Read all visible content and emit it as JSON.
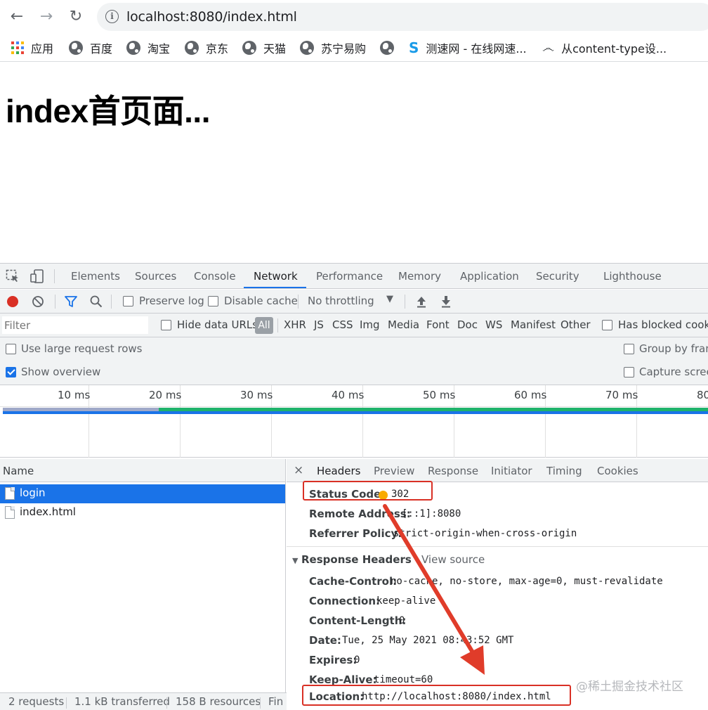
{
  "browser": {
    "url": "localhost:8080/index.html",
    "bookmarks": [
      "应用",
      "百度",
      "淘宝",
      "京东",
      "天猫",
      "苏宁易购",
      "",
      "测速网 - 在线网速...",
      "从content-type设..."
    ]
  },
  "page": {
    "heading": "index首页面..."
  },
  "devtools": {
    "tabs": [
      "Elements",
      "Sources",
      "Console",
      "Network",
      "Performance",
      "Memory",
      "Application",
      "Security",
      "Lighthouse"
    ],
    "active_tab": "Network",
    "toolbar": {
      "preserve_log": "Preserve log",
      "disable_cache": "Disable cache",
      "throttling": "No throttling"
    },
    "filter": {
      "placeholder": "Filter",
      "hide_data_urls": "Hide data URLs",
      "types": [
        "All",
        "XHR",
        "JS",
        "CSS",
        "Img",
        "Media",
        "Font",
        "Doc",
        "WS",
        "Manifest",
        "Other"
      ],
      "has_blocked": "Has blocked cookie"
    },
    "options": {
      "large_rows": "Use large request rows",
      "group_by_frame": "Group by fram",
      "show_overview": "Show overview",
      "capture_screenshots": "Capture screen"
    },
    "timeline_ticks": [
      "10 ms",
      "20 ms",
      "30 ms",
      "40 ms",
      "50 ms",
      "60 ms",
      "70 ms",
      "80"
    ],
    "requests": {
      "column": "Name",
      "rows": [
        "login",
        "index.html"
      ]
    },
    "detail_tabs": [
      "Headers",
      "Preview",
      "Response",
      "Initiator",
      "Timing",
      "Cookies"
    ],
    "general": [
      {
        "key": "Status Code:",
        "value": "302"
      },
      {
        "key": "Remote Address:",
        "value": "[::1]:8080"
      },
      {
        "key": "Referrer Policy:",
        "value": "strict-origin-when-cross-origin"
      }
    ],
    "response_headers_title": "Response Headers",
    "view_source": "View source",
    "response_headers": [
      {
        "key": "Cache-Control:",
        "value": "no-cache, no-store, max-age=0, must-revalidate"
      },
      {
        "key": "Connection:",
        "value": "keep-alive"
      },
      {
        "key": "Content-Length:",
        "value": "0"
      },
      {
        "key": "Date:",
        "value": "Tue, 25 May 2021 08:43:52 GMT"
      },
      {
        "key": "Expires:",
        "value": "0"
      },
      {
        "key": "Keep-Alive:",
        "value": "timeout=60"
      },
      {
        "key": "Location:",
        "value": "http://localhost:8080/index.html"
      }
    ],
    "statusbar": [
      "2 requests",
      "1.1 kB transferred",
      "158 B resources",
      "Fin"
    ]
  },
  "watermark": "@稀土掘金技术社区",
  "colors": {
    "accent": "#1a73e8",
    "annotation": "#d93025",
    "status_dot": "#f9ab00"
  }
}
